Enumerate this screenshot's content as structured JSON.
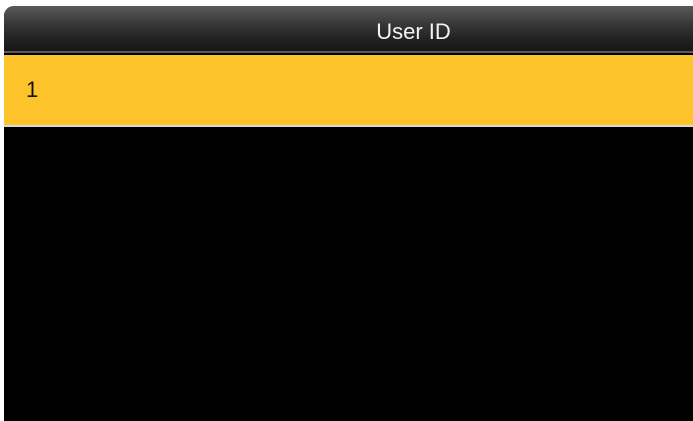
{
  "header": {
    "title": "User ID"
  },
  "list": {
    "items": [
      {
        "label": "1",
        "selected": true
      }
    ]
  },
  "colors": {
    "background": "#000000",
    "selected_row": "#fcc42a",
    "header_text": "#f2f2f2"
  }
}
